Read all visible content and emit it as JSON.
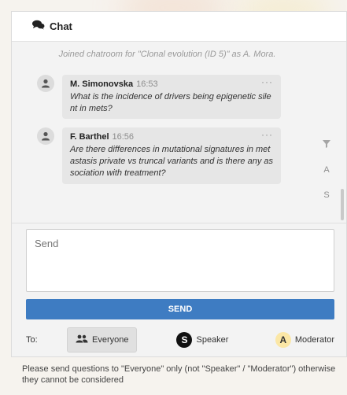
{
  "header": {
    "title": "Chat",
    "icon": "chat-bubbles-icon"
  },
  "system_message": "Joined chatroom for \"Clonal evolution (ID 5)\" as A. Mora.",
  "messages": [
    {
      "author": "M. Simonovska",
      "time": "16:53",
      "text": "What is the incidence of drivers being epigenetic sile nt in mets?"
    },
    {
      "author": "F. Barthel",
      "time": "16:56",
      "text": "Are there differences in mutational signatures in met astasis private vs truncal variants and is there any as sociation with treatment?"
    }
  ],
  "side_tools": [
    "A",
    "S"
  ],
  "input": {
    "placeholder": "Send"
  },
  "send_button": "SEND",
  "recipients": {
    "label": "To:",
    "everyone": "Everyone",
    "speaker": {
      "badge": "S",
      "label": "Speaker"
    },
    "moderator": {
      "badge": "A",
      "label": "Moderator"
    }
  },
  "note": "Please send questions to \"Everyone\" only (not \"Speaker\" / \"Moderator\") otherwise they cannot be considered",
  "colors": {
    "accent": "#3e7cc2",
    "moderator_badge": "#fbe7a6",
    "speaker_badge": "#111111"
  }
}
